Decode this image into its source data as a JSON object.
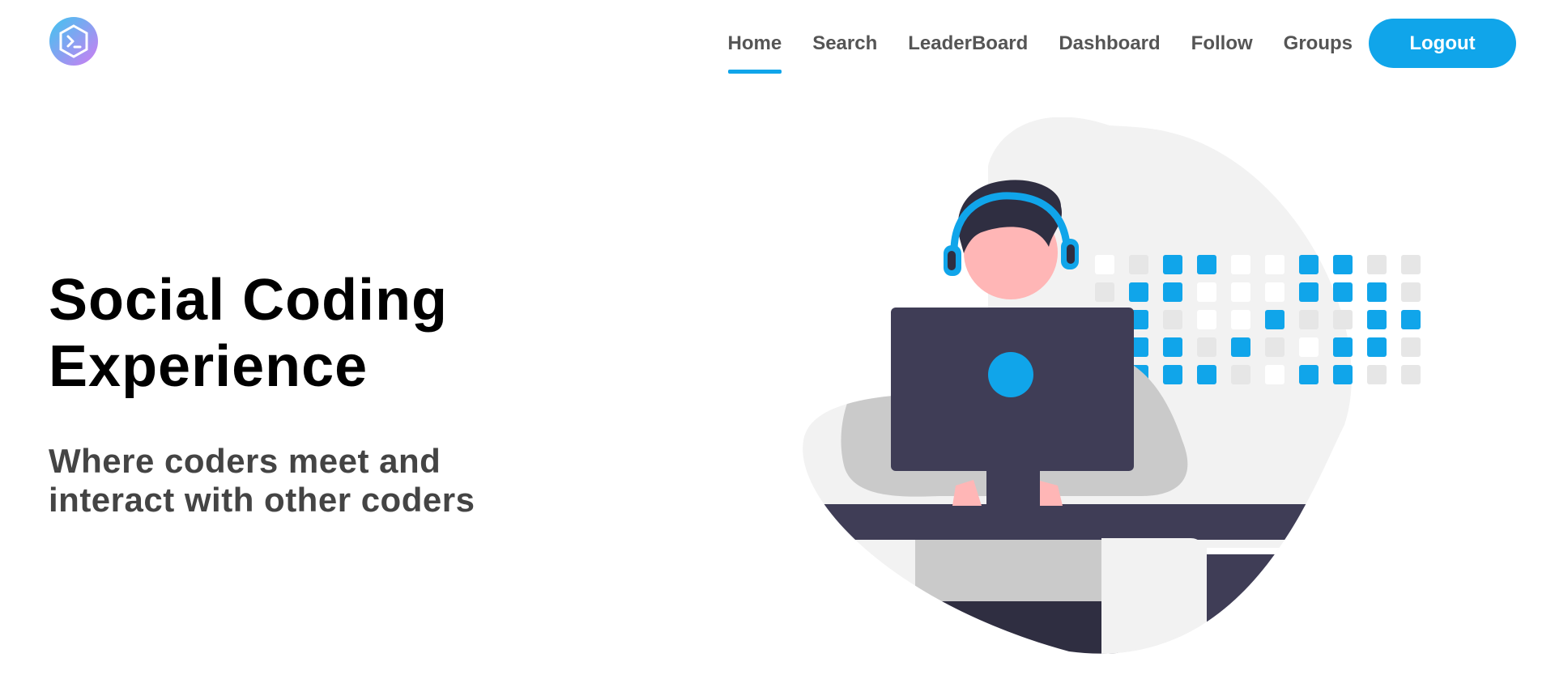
{
  "app": {
    "logo_icon": "terminal-hexagon-icon"
  },
  "nav": {
    "items": [
      {
        "label": "Home",
        "active": true
      },
      {
        "label": "Search",
        "active": false
      },
      {
        "label": "LeaderBoard",
        "active": false
      },
      {
        "label": "Dashboard",
        "active": false
      },
      {
        "label": "Follow",
        "active": false
      },
      {
        "label": "Groups",
        "active": false
      }
    ],
    "logout_label": "Logout"
  },
  "hero": {
    "title_line1": "Social Coding",
    "title_line2": "Experience",
    "subtitle_line1": "Where coders meet and",
    "subtitle_line2": "interact with other coders",
    "illustration": "developer-with-headset-at-computer-illustration"
  },
  "colors": {
    "accent": "#10a5ea",
    "dark": "#3f3d56",
    "skin": "#ffb6b6",
    "light_gray": "#f2f2f2",
    "mid_gray": "#cacaca"
  }
}
